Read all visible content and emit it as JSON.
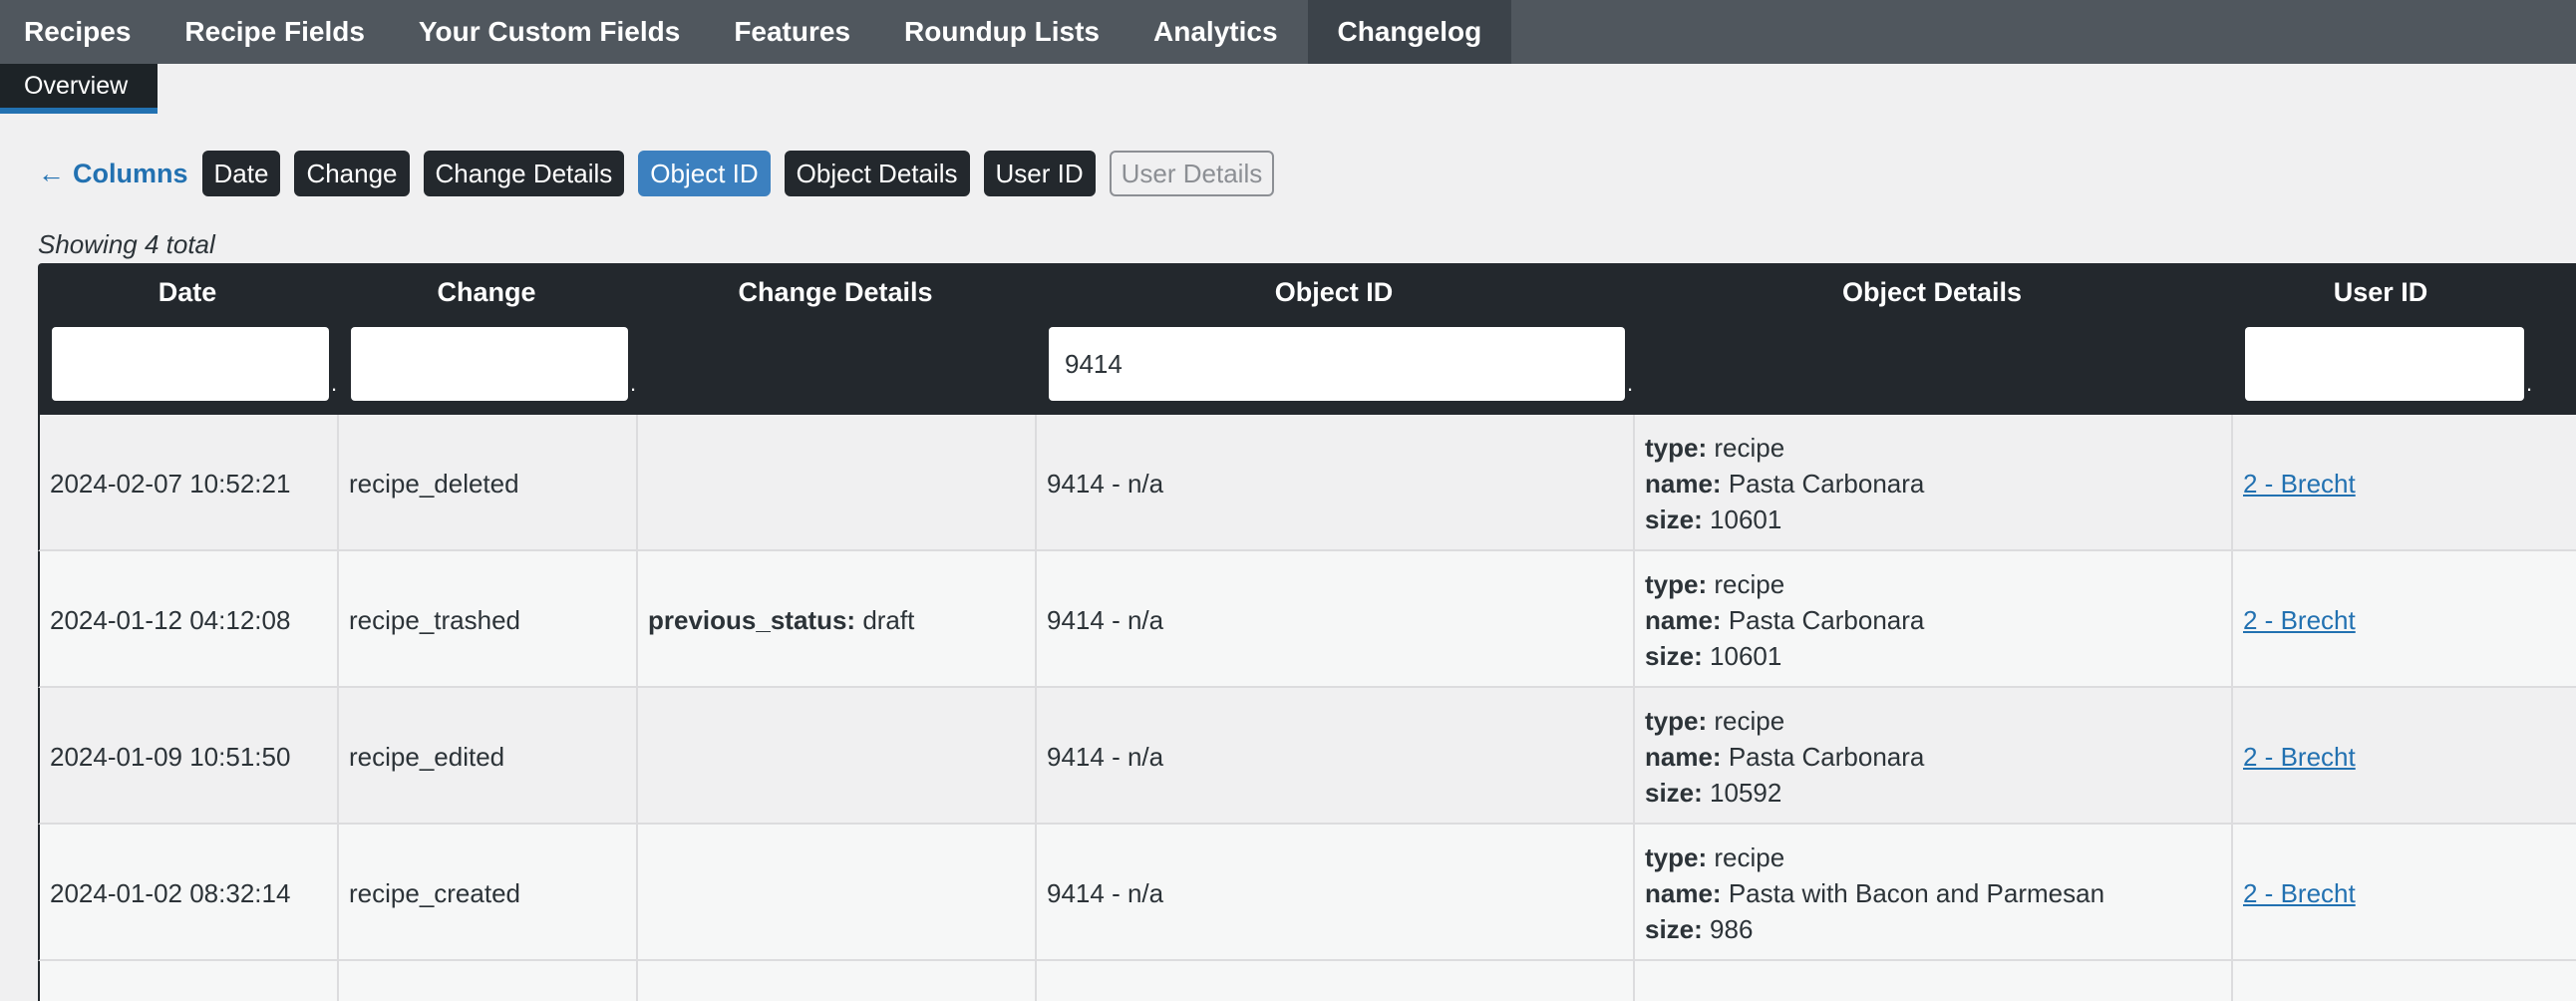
{
  "nav": {
    "tabs": [
      "Recipes",
      "Recipe Fields",
      "Your Custom Fields",
      "Features",
      "Roundup Lists",
      "Analytics",
      "Changelog"
    ],
    "active": "Changelog"
  },
  "subnav": {
    "overview": "Overview"
  },
  "columns": {
    "back_label": "Columns",
    "buttons": [
      {
        "label": "Date",
        "state": "on"
      },
      {
        "label": "Change",
        "state": "on"
      },
      {
        "label": "Change Details",
        "state": "on"
      },
      {
        "label": "Object ID",
        "state": "selected"
      },
      {
        "label": "Object Details",
        "state": "on"
      },
      {
        "label": "User ID",
        "state": "on"
      },
      {
        "label": "User Details",
        "state": "off"
      }
    ]
  },
  "showing": "Showing 4 total",
  "table": {
    "headers": [
      "Date",
      "Change",
      "Change Details",
      "Object ID",
      "Object Details",
      "User ID"
    ],
    "filters": {
      "date": "",
      "change": "",
      "object_id": "9414",
      "user_id": ""
    },
    "rows": [
      {
        "date": "2024-02-07 10:52:21",
        "change": "recipe_deleted",
        "change_details": [],
        "object_id": "9414 - n/a",
        "object_details": [
          {
            "k": "type:",
            "v": "recipe"
          },
          {
            "k": "name:",
            "v": "Pasta Carbonara"
          },
          {
            "k": "size:",
            "v": "10601"
          }
        ],
        "user": "2 - Brecht"
      },
      {
        "date": "2024-01-12 04:12:08",
        "change": "recipe_trashed",
        "change_details": [
          {
            "k": "previous_status:",
            "v": "draft"
          }
        ],
        "object_id": "9414 - n/a",
        "object_details": [
          {
            "k": "type:",
            "v": "recipe"
          },
          {
            "k": "name:",
            "v": "Pasta Carbonara"
          },
          {
            "k": "size:",
            "v": "10601"
          }
        ],
        "user": "2 - Brecht"
      },
      {
        "date": "2024-01-09 10:51:50",
        "change": "recipe_edited",
        "change_details": [],
        "object_id": "9414 - n/a",
        "object_details": [
          {
            "k": "type:",
            "v": "recipe"
          },
          {
            "k": "name:",
            "v": "Pasta Carbonara"
          },
          {
            "k": "size:",
            "v": "10592"
          }
        ],
        "user": "2 - Brecht"
      },
      {
        "date": "2024-01-02 08:32:14",
        "change": "recipe_created",
        "change_details": [],
        "object_id": "9414 - n/a",
        "object_details": [
          {
            "k": "type:",
            "v": "recipe"
          },
          {
            "k": "name:",
            "v": "Pasta with Bacon and Parmesan"
          },
          {
            "k": "size:",
            "v": "986"
          }
        ],
        "user": "2 - Brecht"
      }
    ]
  },
  "colors": {
    "nav_bg": "#50575e",
    "nav_active": "#3c434a",
    "table_head": "#23282d",
    "accent": "#2271b1",
    "selected_btn": "#3c80bf"
  }
}
